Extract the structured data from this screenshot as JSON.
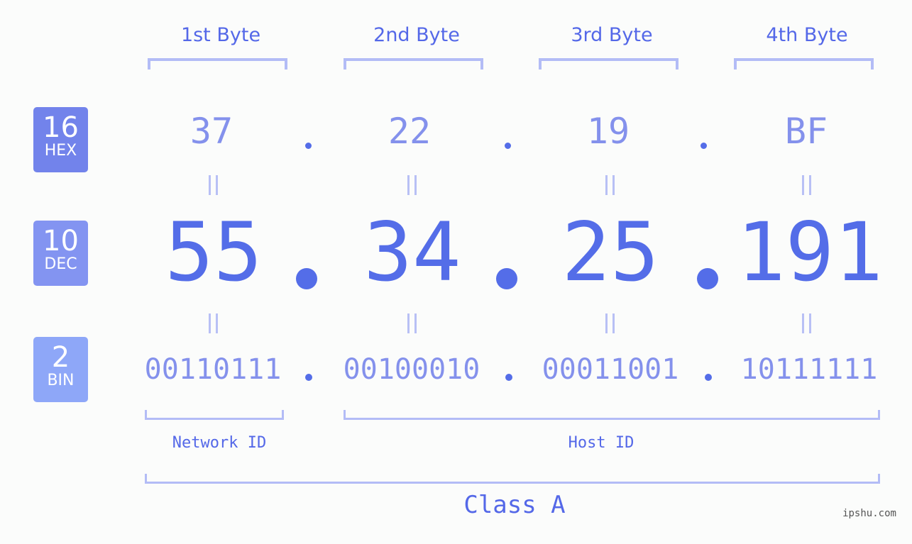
{
  "bytes": [
    {
      "label": "1st Byte",
      "hex": "37",
      "dec": "55",
      "bin": "00110111"
    },
    {
      "label": "2nd Byte",
      "hex": "22",
      "dec": "34",
      "bin": "00100010"
    },
    {
      "label": "3rd Byte",
      "hex": "19",
      "dec": "25",
      "bin": "00011001"
    },
    {
      "label": "4th Byte",
      "hex": "BF",
      "dec": "191",
      "bin": "10111111"
    }
  ],
  "badges": {
    "hex": {
      "number": "16",
      "label": "HEX",
      "color": "#7283eb"
    },
    "dec": {
      "number": "10",
      "label": "DEC",
      "color": "#8394f1"
    },
    "bin": {
      "number": "2",
      "label": "BIN",
      "color": "#8ea7f8"
    }
  },
  "separator": ".",
  "segments": {
    "network": "Network ID",
    "host": "Host ID"
  },
  "ip_class": "Class A",
  "watermark": "ipshu.com"
}
